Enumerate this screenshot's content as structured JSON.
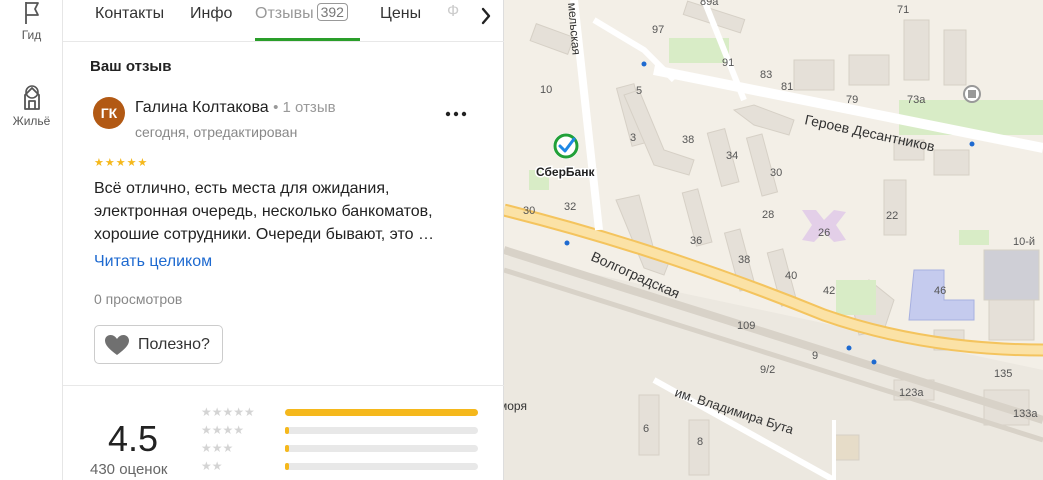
{
  "rail": {
    "items": [
      {
        "label": "Гид",
        "icon": "flag-icon"
      },
      {
        "label": "Жильё",
        "icon": "house-icon"
      }
    ]
  },
  "tabs": {
    "items": [
      {
        "label": "Контакты"
      },
      {
        "label": "Инфо"
      },
      {
        "label": "Отзывы",
        "count": "392",
        "active": true
      },
      {
        "label": "Цены"
      },
      {
        "label": "Ф"
      }
    ]
  },
  "review": {
    "section_title": "Ваш отзыв",
    "avatar_initials": "ГК",
    "avatar_color": "#b25914",
    "author_name": "Галина Колтакова",
    "author_meta": "• 1 отзыв",
    "date": "сегодня, отредактирован",
    "rating": 5,
    "stars": "★★★★★",
    "text": "Всё отлично, есть места для ожидания, электронная очередь, несколько банкоматов, хорошие сотрудники. Очереди бывают, это …",
    "read_more": "Читать целиком",
    "views": "0 просмотров",
    "useful_label": "Полезно?"
  },
  "summary": {
    "rating": "4.5",
    "count_label": "430 оценок",
    "distribution": [
      {
        "stars": "★★★★★",
        "fraction": 1.0
      },
      {
        "stars": "★★★★",
        "fraction": 0.02
      },
      {
        "stars": "★★★",
        "fraction": 0.02
      },
      {
        "stars": "★★",
        "fraction": 0.02
      }
    ]
  },
  "map": {
    "poi_name": "СберБанк",
    "streets": [
      "Героев Десантников",
      "Волгоградская",
      "им. Владимира Бута",
      "мельская",
      "моря"
    ],
    "house_numbers": [
      "89а",
      "97",
      "71",
      "91",
      "83",
      "81",
      "79",
      "73а",
      "10",
      "5",
      "3",
      "38",
      "34",
      "30",
      "32",
      "30",
      "28",
      "22",
      "26",
      "36",
      "38",
      "40",
      "42",
      "10-й",
      "46",
      "109",
      "9",
      "9/2",
      "135",
      "123а",
      "133а",
      "6",
      "8"
    ],
    "accent": "#2a9e2a"
  }
}
